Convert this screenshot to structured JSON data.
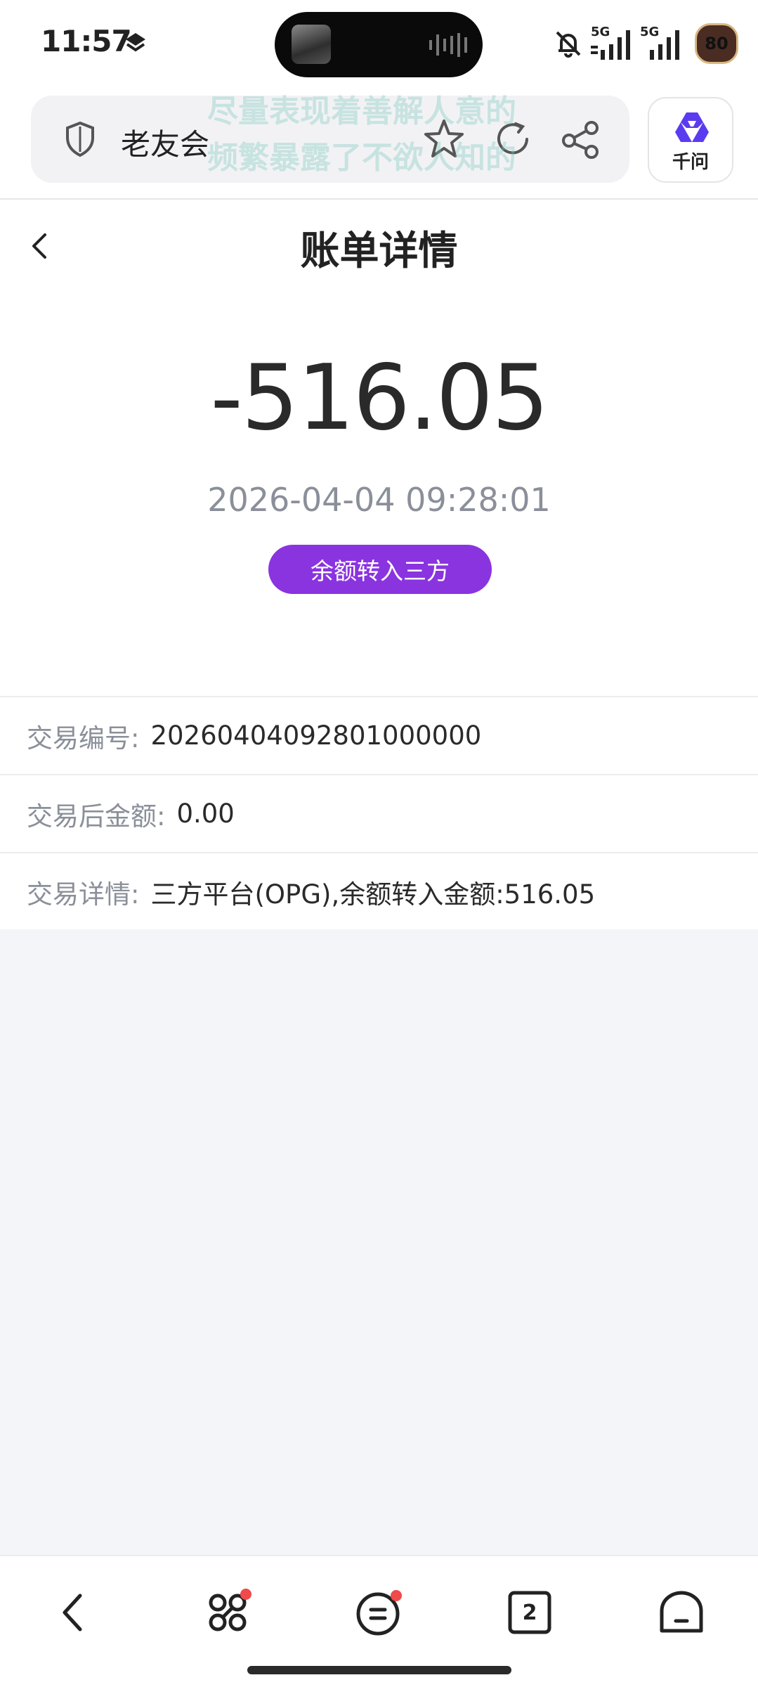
{
  "status_bar": {
    "time": "11:57",
    "signal_1_label": "5G",
    "signal_2_label": "5G",
    "battery_level": "80"
  },
  "browser": {
    "site_title": "老友会",
    "overlay_line_1": "尽量表现着善解人意的",
    "overlay_line_2": "频繁暴露了不欲人知的",
    "ai_label": "千问",
    "tab_count": "2"
  },
  "page": {
    "title": "账单详情",
    "amount": "-516.05",
    "datetime": "2026-04-04 09:28:01",
    "type_badge": "余额转入三方",
    "accent_color": "#8a34e0"
  },
  "details": [
    {
      "label": "交易编号:",
      "value": "20260404092801000000"
    },
    {
      "label": "交易后金额:",
      "value": "0.00"
    },
    {
      "label": "交易详情:",
      "value": "三方平台(OPG),余额转入金额:516.05"
    }
  ],
  "icons": {
    "status": [
      "layers-icon",
      "music-island-thumb",
      "audio-wave-icon",
      "mute-icon",
      "signal-icon",
      "battery-icon"
    ],
    "browser": [
      "shield-icon",
      "star-icon",
      "refresh-icon",
      "share-icon",
      "ai-logo-icon"
    ],
    "nav": [
      "back-icon",
      "tools-icon",
      "menu-icon",
      "tabs-icon",
      "home-icon"
    ]
  }
}
